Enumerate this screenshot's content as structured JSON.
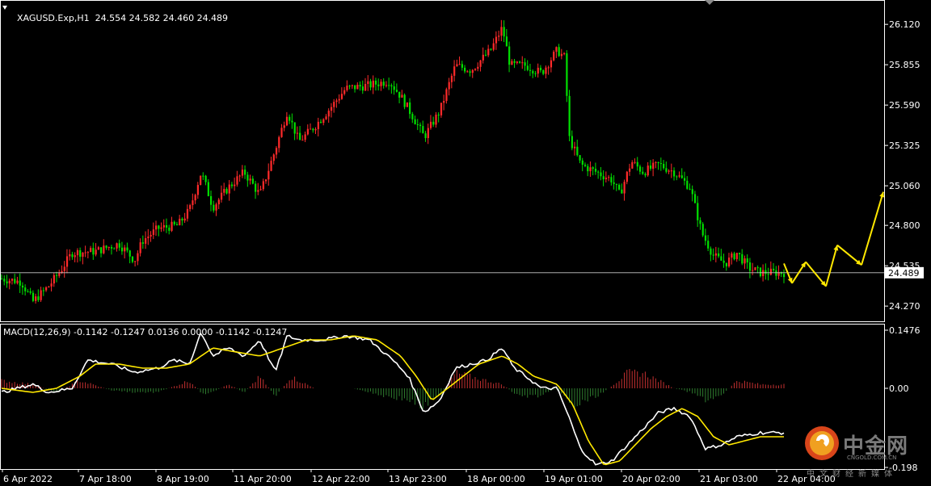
{
  "header": {
    "symbol": "XAGUSD.Exp,H1",
    "ohlc": "24.554 24.582 24.460 24.489",
    "macd_label": "MACD(12,26,9) -0.1142 -0.1247 0.0136 0.0000 -0.1142 -0.1247"
  },
  "colors": {
    "background": "#000000",
    "bull": "#ff2a2a",
    "bear": "#00e000",
    "macd_line": "#ffffff",
    "signal_line": "#ffe800",
    "hist_pos": "#c43030",
    "hist_neg": "#2f7d2f",
    "forecast": "#ffe800",
    "price_line": "#c8c8c8",
    "grid_border": "#ffffff"
  },
  "chart_data": [
    {
      "type": "candlestick",
      "symbol": "XAGUSD.Exp",
      "timeframe": "H1",
      "ylim": [
        24.17,
        26.28
      ],
      "y_ticks": [
        "26.120",
        "25.855",
        "25.590",
        "25.325",
        "25.060",
        "24.800",
        "24.535",
        "24.270"
      ],
      "y_tick_values": [
        26.12,
        25.855,
        25.59,
        25.325,
        25.06,
        24.8,
        24.535,
        24.27
      ],
      "current_price": "24.489",
      "current_price_value": 24.489,
      "x_labels": [
        "6 Apr 2022",
        "7 Apr 18:00",
        "8 Apr 19:00",
        "11 Apr 20:00",
        "12 Apr 22:00",
        "13 Apr 23:00",
        "18 Apr 00:00",
        "19 Apr 01:00",
        "20 Apr 02:00",
        "21 Apr 03:00",
        "22 Apr 04:00"
      ],
      "price_path": [
        [
          0,
          24.45
        ],
        [
          0.025,
          24.43
        ],
        [
          0.04,
          24.3
        ],
        [
          0.06,
          24.4
        ],
        [
          0.075,
          24.5
        ],
        [
          0.09,
          24.62
        ],
        [
          0.12,
          24.63
        ],
        [
          0.15,
          24.68
        ],
        [
          0.17,
          24.57
        ],
        [
          0.18,
          24.7
        ],
        [
          0.2,
          24.78
        ],
        [
          0.225,
          24.8
        ],
        [
          0.24,
          24.9
        ],
        [
          0.255,
          25.15
        ],
        [
          0.27,
          24.92
        ],
        [
          0.29,
          25.05
        ],
        [
          0.31,
          25.15
        ],
        [
          0.33,
          25.0
        ],
        [
          0.35,
          25.3
        ],
        [
          0.365,
          25.55
        ],
        [
          0.38,
          25.35
        ],
        [
          0.4,
          25.45
        ],
        [
          0.42,
          25.57
        ],
        [
          0.44,
          25.7
        ],
        [
          0.47,
          25.72
        ],
        [
          0.495,
          25.75
        ],
        [
          0.51,
          25.65
        ],
        [
          0.525,
          25.52
        ],
        [
          0.54,
          25.38
        ],
        [
          0.56,
          25.55
        ],
        [
          0.58,
          25.85
        ],
        [
          0.6,
          25.82
        ],
        [
          0.625,
          25.95
        ],
        [
          0.64,
          26.1
        ],
        [
          0.65,
          25.85
        ],
        [
          0.67,
          25.85
        ],
        [
          0.69,
          25.8
        ],
        [
          0.71,
          25.95
        ],
        [
          0.72,
          25.9
        ],
        [
          0.725,
          25.38
        ],
        [
          0.74,
          25.2
        ],
        [
          0.76,
          25.15
        ],
        [
          0.78,
          25.1
        ],
        [
          0.79,
          25.0
        ],
        [
          0.805,
          25.22
        ],
        [
          0.82,
          25.15
        ],
        [
          0.84,
          25.2
        ],
        [
          0.86,
          25.15
        ],
        [
          0.88,
          25.05
        ],
        [
          0.895,
          24.75
        ],
        [
          0.91,
          24.6
        ],
        [
          0.925,
          24.55
        ],
        [
          0.94,
          24.62
        ],
        [
          0.955,
          24.52
        ],
        [
          0.97,
          24.49
        ]
      ],
      "forecast_points": [
        [
          24.55,
          24.42
        ],
        [
          24.42,
          24.56
        ],
        [
          24.56,
          24.4
        ],
        [
          24.4,
          24.67
        ],
        [
          24.67,
          24.54
        ],
        [
          24.54,
          25.02
        ]
      ]
    },
    {
      "type": "line",
      "title": "MACD(12,26,9)",
      "ylim": [
        -0.2,
        0.16
      ],
      "y_ticks": [
        "0.1476",
        "0.00",
        "-0.198"
      ],
      "y_tick_values": [
        0.1476,
        0.0,
        -0.198
      ],
      "series": [
        {
          "name": "macd",
          "path": [
            [
              0,
              -0.01
            ],
            [
              0.04,
              0.01
            ],
            [
              0.06,
              -0.01
            ],
            [
              0.09,
              0.0
            ],
            [
              0.11,
              0.07
            ],
            [
              0.14,
              0.06
            ],
            [
              0.17,
              0.04
            ],
            [
              0.2,
              0.05
            ],
            [
              0.22,
              0.07
            ],
            [
              0.24,
              0.06
            ],
            [
              0.255,
              0.14
            ],
            [
              0.27,
              0.08
            ],
            [
              0.29,
              0.1
            ],
            [
              0.31,
              0.08
            ],
            [
              0.33,
              0.12
            ],
            [
              0.35,
              0.04
            ],
            [
              0.365,
              0.13
            ],
            [
              0.38,
              0.12
            ],
            [
              0.41,
              0.12
            ],
            [
              0.44,
              0.13
            ],
            [
              0.47,
              0.12
            ],
            [
              0.5,
              0.07
            ],
            [
              0.52,
              0.03
            ],
            [
              0.54,
              -0.06
            ],
            [
              0.56,
              -0.03
            ],
            [
              0.58,
              0.05
            ],
            [
              0.6,
              0.06
            ],
            [
              0.62,
              0.07
            ],
            [
              0.64,
              0.1
            ],
            [
              0.655,
              0.05
            ],
            [
              0.67,
              0.03
            ],
            [
              0.69,
              0.0
            ],
            [
              0.71,
              0.0
            ],
            [
              0.725,
              -0.07
            ],
            [
              0.74,
              -0.15
            ],
            [
              0.76,
              -0.19
            ],
            [
              0.78,
              -0.18
            ],
            [
              0.8,
              -0.14
            ],
            [
              0.82,
              -0.1
            ],
            [
              0.84,
              -0.06
            ],
            [
              0.86,
              -0.05
            ],
            [
              0.88,
              -0.07
            ],
            [
              0.9,
              -0.15
            ],
            [
              0.92,
              -0.14
            ],
            [
              0.94,
              -0.12
            ],
            [
              0.97,
              -0.11
            ]
          ]
        },
        {
          "name": "signal",
          "path": [
            [
              0,
              0.0
            ],
            [
              0.04,
              -0.01
            ],
            [
              0.07,
              0.0
            ],
            [
              0.1,
              0.03
            ],
            [
              0.12,
              0.06
            ],
            [
              0.15,
              0.06
            ],
            [
              0.18,
              0.05
            ],
            [
              0.21,
              0.05
            ],
            [
              0.24,
              0.06
            ],
            [
              0.27,
              0.1
            ],
            [
              0.3,
              0.09
            ],
            [
              0.33,
              0.08
            ],
            [
              0.36,
              0.1
            ],
            [
              0.39,
              0.12
            ],
            [
              0.42,
              0.12
            ],
            [
              0.45,
              0.13
            ],
            [
              0.48,
              0.12
            ],
            [
              0.51,
              0.08
            ],
            [
              0.53,
              0.03
            ],
            [
              0.55,
              -0.03
            ],
            [
              0.57,
              0.0
            ],
            [
              0.59,
              0.03
            ],
            [
              0.61,
              0.06
            ],
            [
              0.64,
              0.08
            ],
            [
              0.66,
              0.06
            ],
            [
              0.68,
              0.03
            ],
            [
              0.71,
              0.01
            ],
            [
              0.73,
              -0.04
            ],
            [
              0.75,
              -0.13
            ],
            [
              0.77,
              -0.19
            ],
            [
              0.79,
              -0.18
            ],
            [
              0.81,
              -0.14
            ],
            [
              0.83,
              -0.1
            ],
            [
              0.85,
              -0.07
            ],
            [
              0.87,
              -0.05
            ],
            [
              0.89,
              -0.07
            ],
            [
              0.91,
              -0.12
            ],
            [
              0.93,
              -0.14
            ],
            [
              0.95,
              -0.13
            ],
            [
              0.97,
              -0.12
            ]
          ]
        }
      ],
      "histogram_path": [
        [
          0,
          0.02
        ],
        [
          0.04,
          0.01
        ],
        [
          0.07,
          -0.01
        ],
        [
          0.1,
          0.02
        ],
        [
          0.14,
          -0.005
        ],
        [
          0.17,
          -0.01
        ],
        [
          0.2,
          -0.01
        ],
        [
          0.24,
          0.02
        ],
        [
          0.26,
          -0.02
        ],
        [
          0.29,
          0.01
        ],
        [
          0.31,
          -0.01
        ],
        [
          0.33,
          0.03
        ],
        [
          0.35,
          -0.02
        ],
        [
          0.37,
          0.03
        ],
        [
          0.4,
          0.0
        ],
        [
          0.45,
          0.0
        ],
        [
          0.49,
          -0.02
        ],
        [
          0.52,
          -0.03
        ],
        [
          0.54,
          -0.05
        ],
        [
          0.56,
          -0.02
        ],
        [
          0.58,
          0.04
        ],
        [
          0.6,
          0.03
        ],
        [
          0.62,
          0.02
        ],
        [
          0.64,
          0.01
        ],
        [
          0.66,
          -0.02
        ],
        [
          0.69,
          -0.02
        ],
        [
          0.71,
          0.0
        ],
        [
          0.73,
          -0.05
        ],
        [
          0.75,
          -0.03
        ],
        [
          0.77,
          -0.01
        ],
        [
          0.8,
          0.04
        ],
        [
          0.82,
          0.04
        ],
        [
          0.84,
          0.02
        ],
        [
          0.86,
          0.0
        ],
        [
          0.88,
          -0.01
        ],
        [
          0.9,
          -0.03
        ],
        [
          0.92,
          -0.02
        ],
        [
          0.94,
          0.02
        ],
        [
          0.97,
          0.01
        ]
      ]
    }
  ],
  "watermark": {
    "brand": "中金网",
    "domain": "CNGOLD.COM.CN",
    "tagline": "中文财经新媒体"
  }
}
